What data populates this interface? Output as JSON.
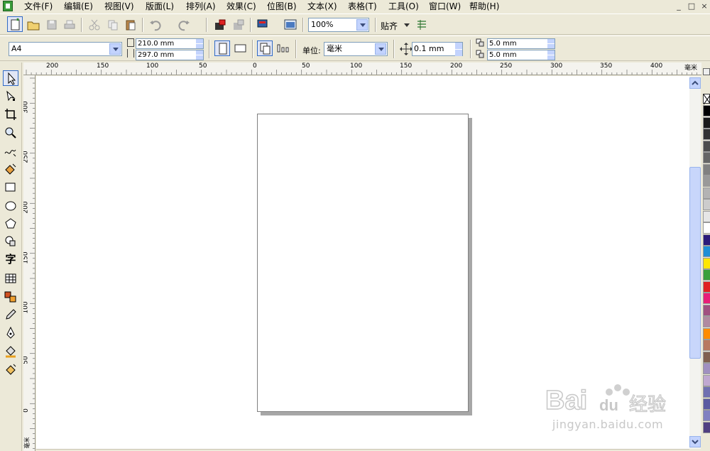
{
  "menu": {
    "items": [
      "文件(F)",
      "编辑(E)",
      "视图(V)",
      "版面(L)",
      "排列(A)",
      "效果(C)",
      "位图(B)",
      "文本(X)",
      "表格(T)",
      "工具(O)",
      "窗口(W)",
      "帮助(H)"
    ],
    "window_controls": [
      "_",
      "□",
      "×"
    ]
  },
  "toolbar": {
    "zoom": "100%",
    "snap_label": "贴齐"
  },
  "property_bar": {
    "paper_size": "A4",
    "width": "210.0 mm",
    "height": "297.0 mm",
    "unit_label": "单位:",
    "unit": "毫米",
    "nudge": "0.1 mm",
    "dup_x": "5.0 mm",
    "dup_y": "5.0 mm"
  },
  "rulers": {
    "horizontal_ticks": [
      "200",
      "150",
      "100",
      "50",
      "0",
      "50",
      "100",
      "150",
      "200",
      "250",
      "300",
      "350",
      "400"
    ],
    "horizontal_unit": "毫米",
    "vertical_ticks": [
      "300",
      "250",
      "200",
      "150",
      "100",
      "50",
      "0"
    ],
    "vertical_unit": "毫米"
  },
  "palette": {
    "colors": [
      "#000000",
      "#1a1a1a",
      "#333333",
      "#4d4d4d",
      "#666666",
      "#808080",
      "#999999",
      "#b3b3b3",
      "#cccccc",
      "#e6e6e6",
      "#ffffff",
      "#2b1a7a",
      "#1f8fd6",
      "#ffe600",
      "#3aa03a",
      "#e02020",
      "#e81e78",
      "#a05080",
      "#b08aa0",
      "#ff8c00",
      "#b87860",
      "#806050",
      "#a090c0",
      "#c0a8d0",
      "#7070b0",
      "#5a5aa0",
      "#8080c0",
      "#504080"
    ]
  },
  "watermark": {
    "logo": "Bai du 经验",
    "url": "jingyan.baidu.com"
  }
}
